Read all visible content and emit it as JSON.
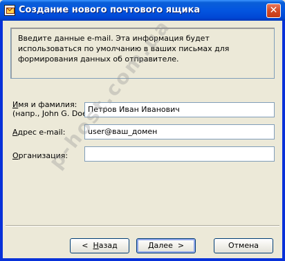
{
  "window": {
    "title": "Создание нового почтового ящика",
    "icon": "mail-app-icon",
    "close_glyph": "✕"
  },
  "info": {
    "text": "Введите данные e-mail. Эта информация будет использоваться по умолчанию в ваших письмах для формирования данных об отправителе."
  },
  "form": {
    "name": {
      "label_line1_access": "И",
      "label_line1_rest": "мя и фамилия:",
      "label_line2": "(напр., John G. Doe)",
      "value": "Петров Иван Иванович"
    },
    "email": {
      "label_access": "А",
      "label_rest": "дрес e-mail:",
      "value": "user@ваш_домен"
    },
    "org": {
      "label_access": "О",
      "label_rest": "рганизация:",
      "value": ""
    }
  },
  "buttons": {
    "back_arrow": "<",
    "back_access": "Н",
    "back_rest": "азад",
    "next_access": "Д",
    "next_rest": "алее",
    "next_arrow": ">",
    "cancel": "Отмена"
  },
  "watermark": "p-host.com.ua"
}
